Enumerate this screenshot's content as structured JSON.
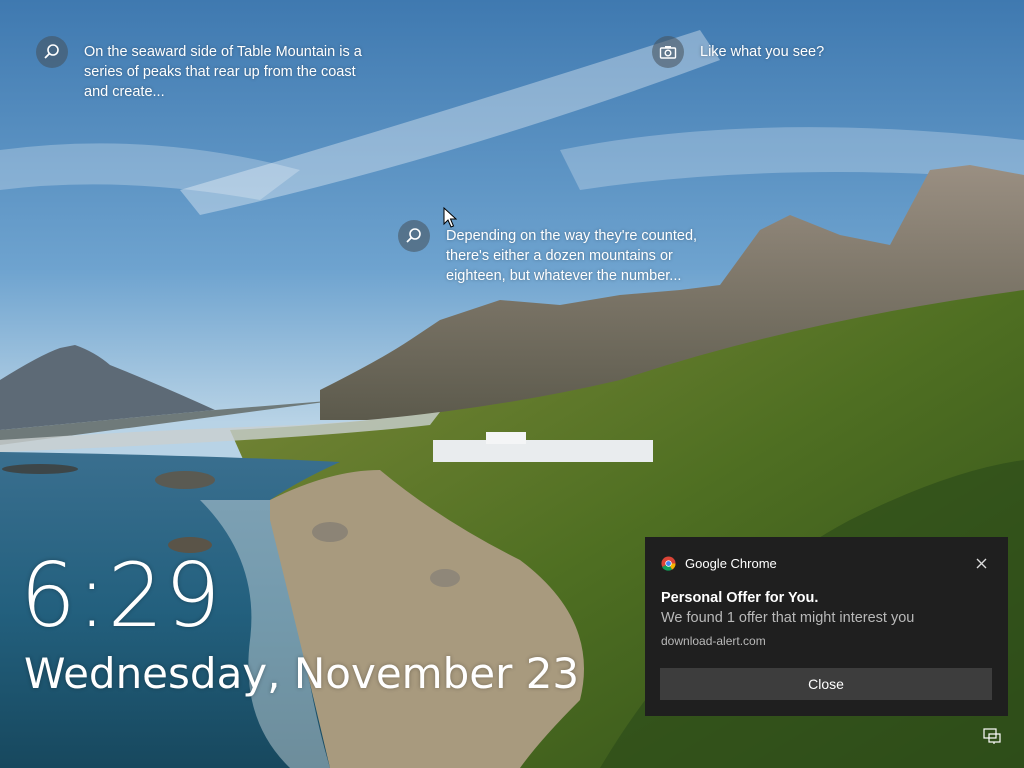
{
  "lockscreen": {
    "hotspots": [
      {
        "text": "On the seaward side of Table Mountain is a series of peaks that rear up from the coast and create...",
        "icon": "search-icon"
      },
      {
        "text": "Depending on the way they're counted, there's either a dozen mountains or eighteen, but whatever the number...",
        "icon": "search-icon"
      },
      {
        "text": "Like what you see?",
        "icon": "camera-icon"
      }
    ],
    "time": "6:29",
    "date": "Wednesday, November 23"
  },
  "notification": {
    "app_name": "Google Chrome",
    "app_icon": "chrome-icon",
    "title": "Personal Offer for You.",
    "body": "We found 1 offer that might interest you",
    "source": "download-alert.com",
    "button_label": "Close",
    "close_icon": "close-icon"
  },
  "system_tray": {
    "network_icon": "network-icon"
  },
  "colors": {
    "toast_bg": "#1f1f1f",
    "toast_button": "#3d3d3d",
    "secondary_text": "#b9b9b9"
  }
}
